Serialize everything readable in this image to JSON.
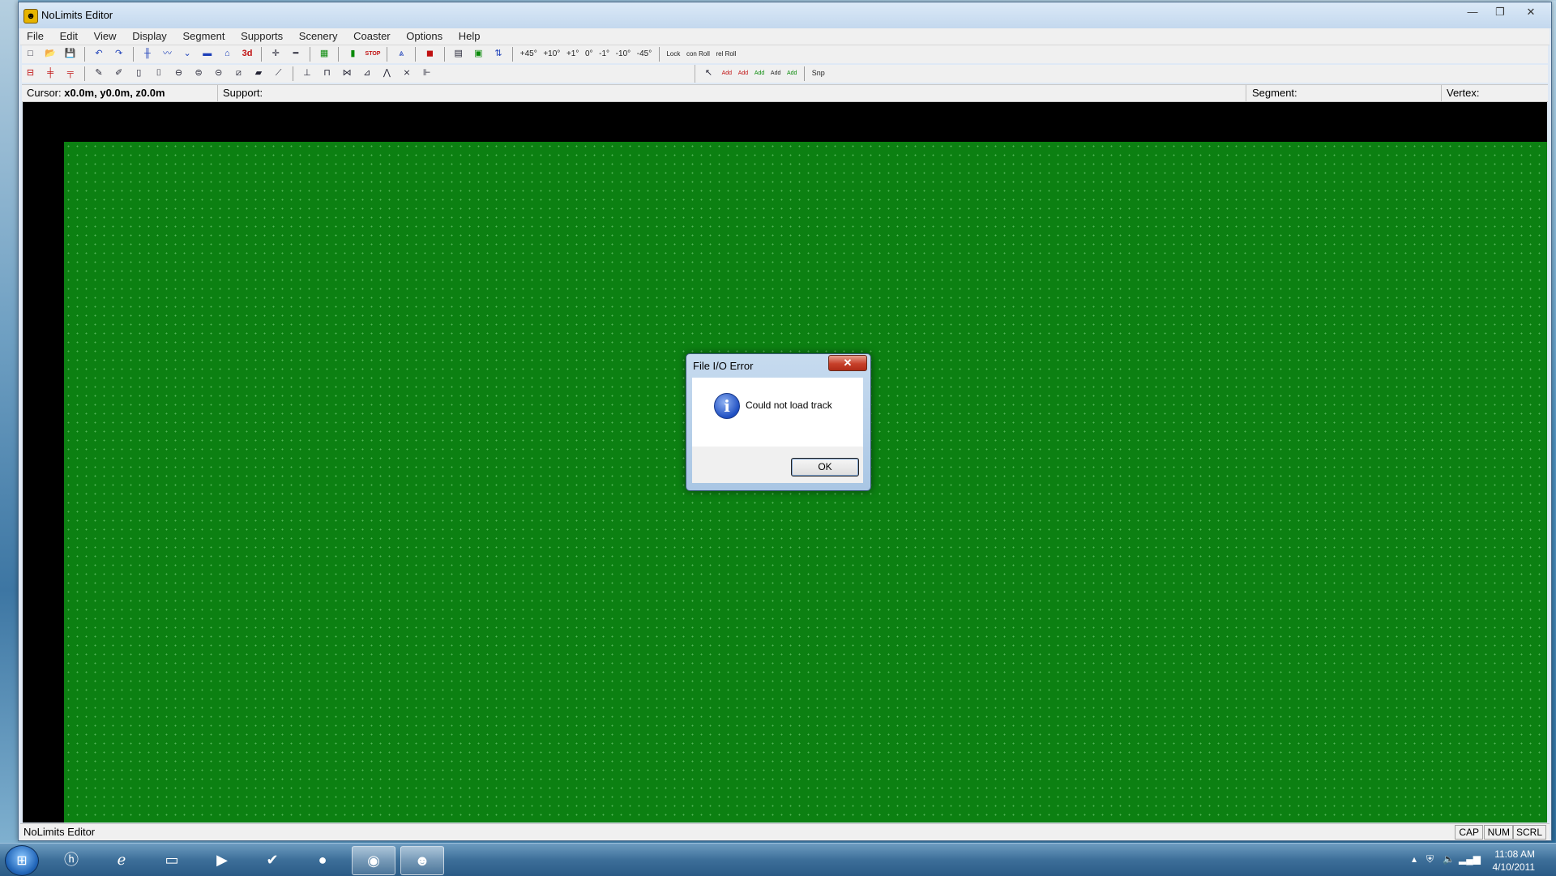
{
  "window": {
    "title": "NoLimits Editor",
    "min": "—",
    "max": "❐",
    "close": "✕"
  },
  "menu": [
    "File",
    "Edit",
    "View",
    "Display",
    "Segment",
    "Supports",
    "Scenery",
    "Coaster",
    "Options",
    "Help"
  ],
  "toolbar": {
    "label_3d": "3d",
    "stop": "STOP",
    "angles": [
      "+45°",
      "+10°",
      "+1°",
      "0°",
      "-1°",
      "-10°",
      "-45°"
    ],
    "lock": "Lock",
    "con_roll": "con Roll",
    "rel_roll": "rel Roll",
    "add": "Add",
    "snp": "Snp"
  },
  "status": {
    "cursor_label": "Cursor:",
    "cursor_value": "x0.0m, y0.0m, z0.0m",
    "support_label": "Support:",
    "segment_label": "Segment:",
    "vertex_label": "Vertex:"
  },
  "bottom_status": {
    "label": "NoLimits Editor",
    "cap": "CAP",
    "num": "NUM",
    "scrl": "SCRL"
  },
  "dialog": {
    "title": "File I/O Error",
    "close": "✕",
    "message": "Could not load track",
    "ok": "OK",
    "icon_glyph": "i"
  },
  "taskbar": {
    "start": "⊞",
    "time": "11:08 AM",
    "date": "4/10/2011"
  },
  "colors": {
    "grid": "#0c8012",
    "viewport_border": "#000000",
    "close_red": "#c7402a"
  }
}
